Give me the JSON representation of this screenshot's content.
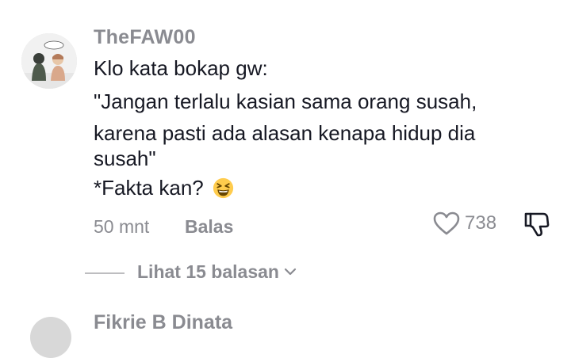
{
  "comment": {
    "username": "TheFAW00",
    "lines": [
      "Klo kata bokap gw:",
      "\"Jangan terlalu kasian sama orang susah,",
      "karena pasti ada alasan kenapa hidup dia",
      "susah\"",
      "*Fakta kan?"
    ],
    "emoji": "grinning-squinting-face",
    "time": "50 mnt",
    "reply_label": "Balas",
    "like_count": "738"
  },
  "replies": {
    "view_label": "Lihat 15 balasan"
  },
  "next_comment": {
    "username": "Fikrie B Dinata"
  }
}
